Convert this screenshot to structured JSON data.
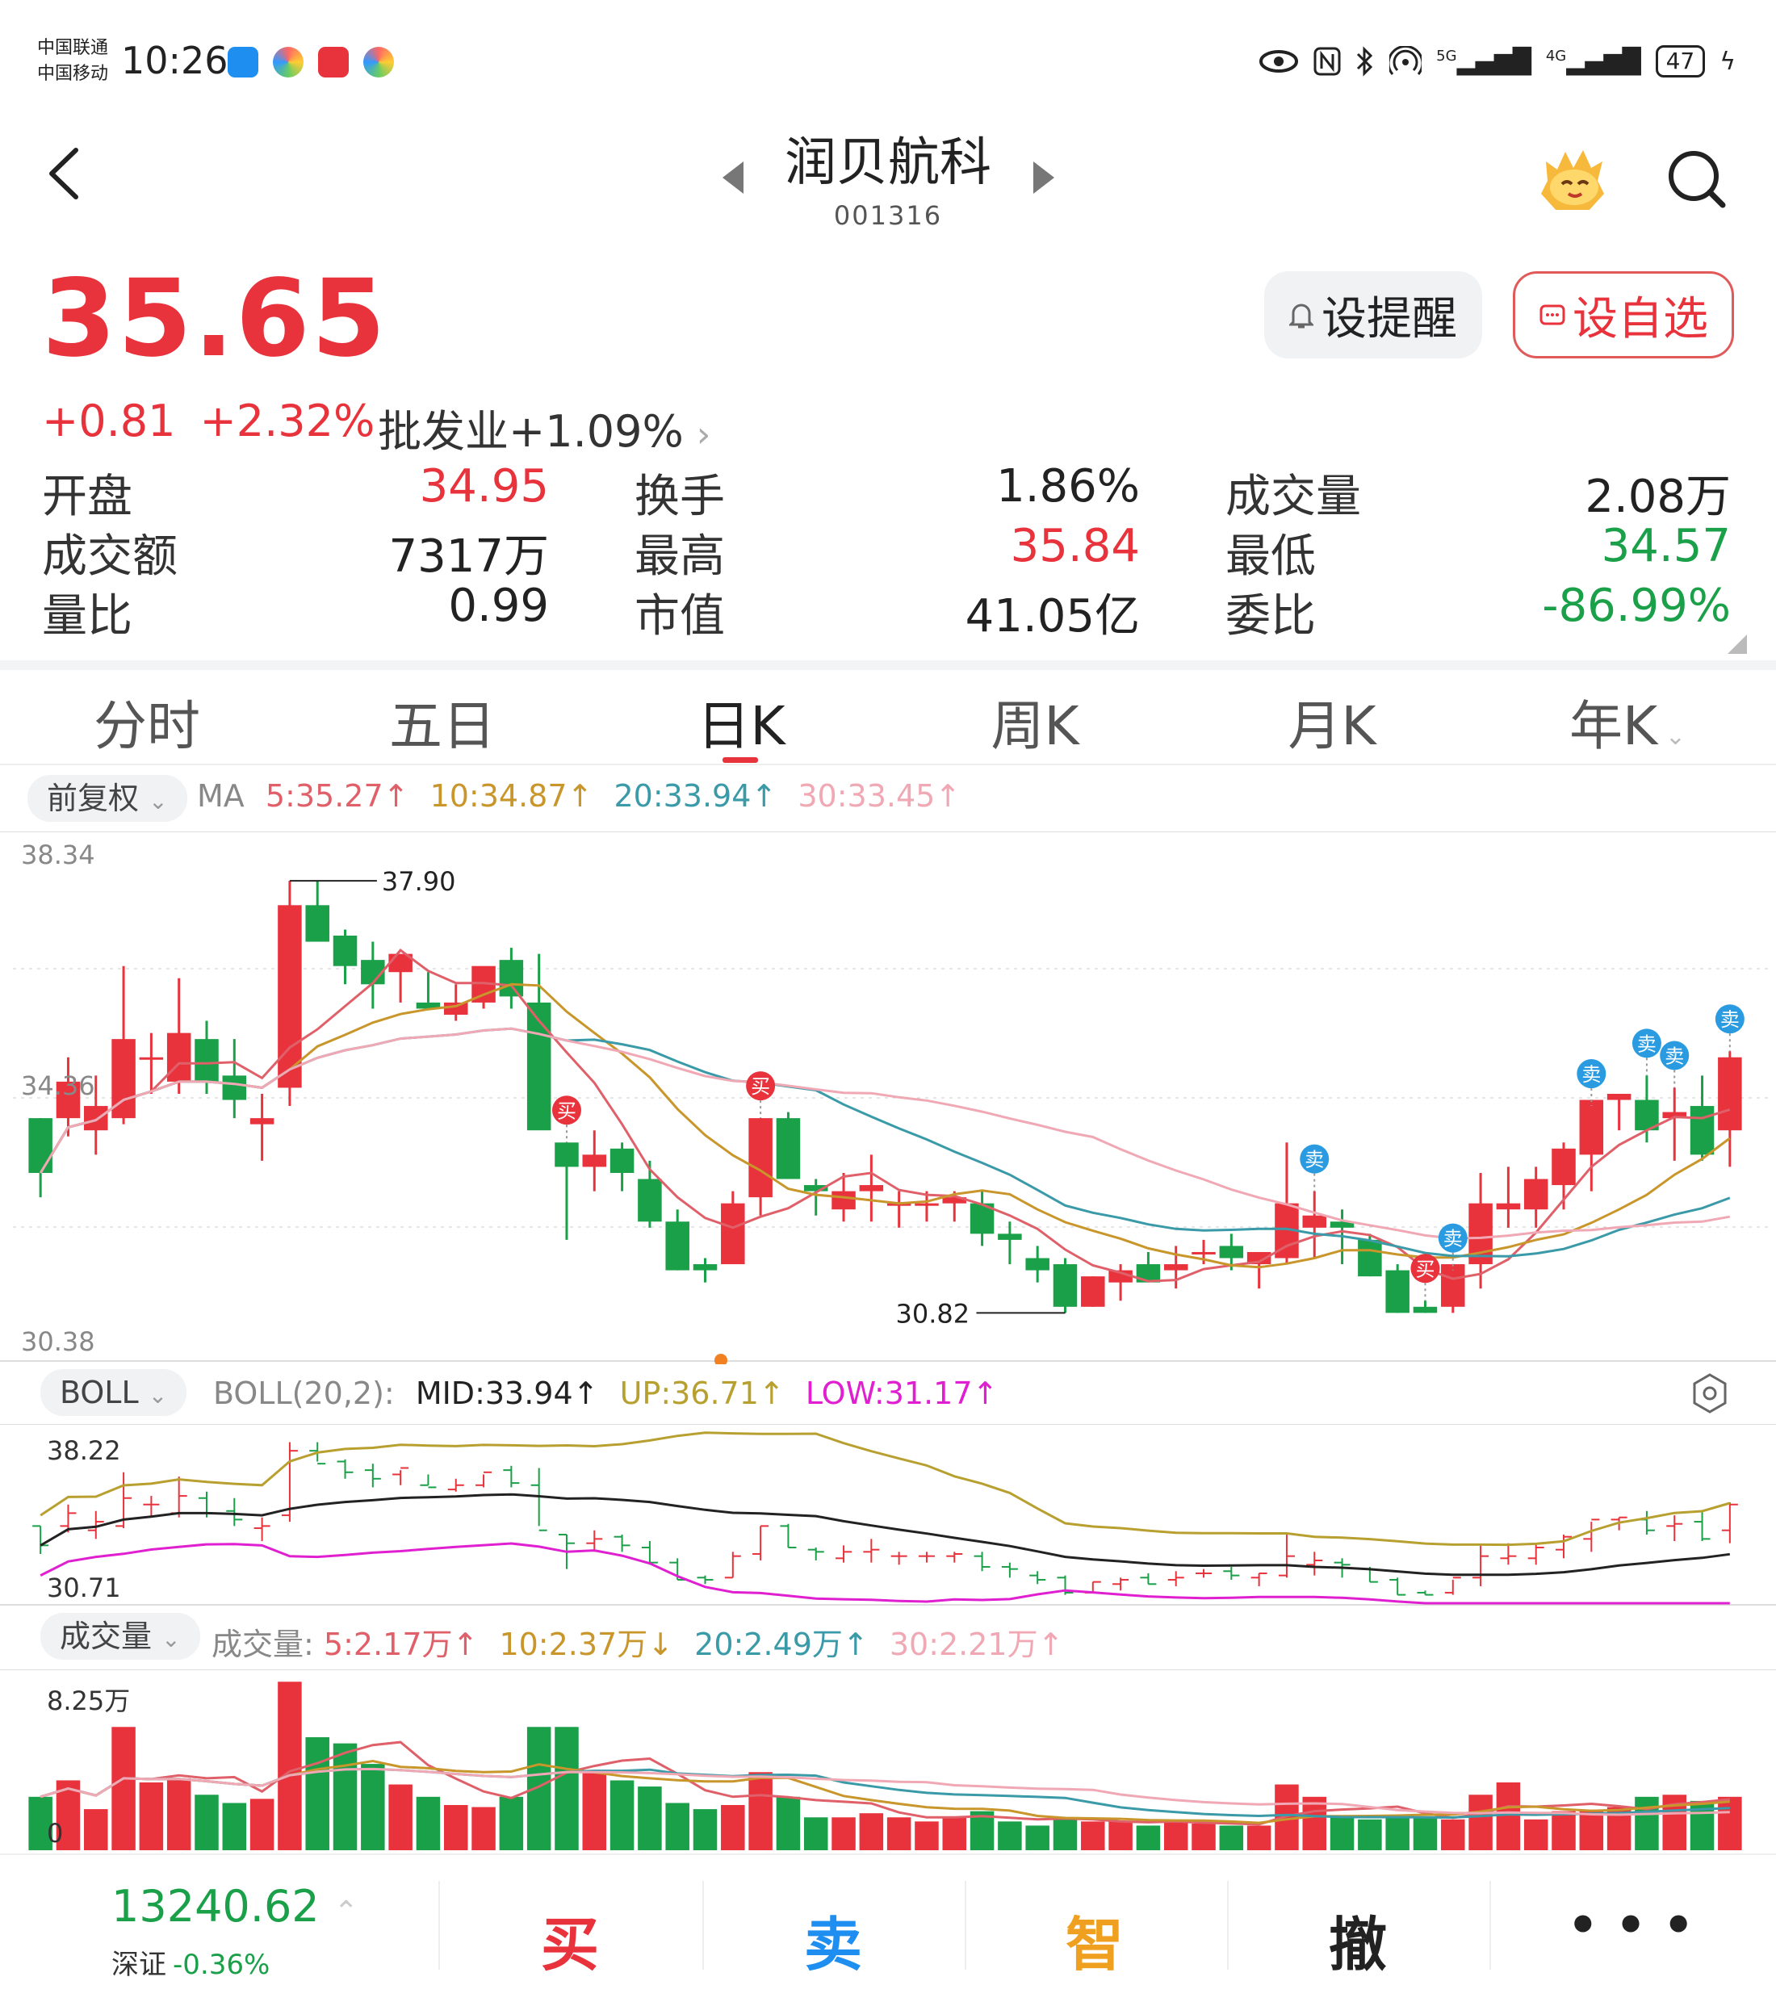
{
  "status_bar": {
    "carrier1": "中国联通",
    "carrier2": "中国移动",
    "time": "10:26",
    "signal1": "5G",
    "signal2": "4G",
    "battery": "47",
    "icons": [
      "message-icon",
      "app-icon",
      "app-icon",
      "app-icon",
      "eye-icon",
      "nfc-icon",
      "bluetooth-icon",
      "hotspot-icon"
    ]
  },
  "header": {
    "title": "润贝航科",
    "code": "001316"
  },
  "quote": {
    "price": "35.65",
    "change": "+0.81",
    "change_pct": "+2.32%",
    "sector": "批发业+1.09%",
    "alert_button": "设提醒",
    "fav_button": "设自选"
  },
  "stats": [
    {
      "label": "开盘",
      "value": "34.95",
      "color": "red"
    },
    {
      "label": "换手",
      "value": "1.86%",
      "color": "dark"
    },
    {
      "label": "成交量",
      "value": "2.08万",
      "color": "dark"
    },
    {
      "label": "成交额",
      "value": "7317万",
      "color": "dark"
    },
    {
      "label": "最高",
      "value": "35.84",
      "color": "red"
    },
    {
      "label": "最低",
      "value": "34.57",
      "color": "green"
    },
    {
      "label": "量比",
      "value": "0.99",
      "color": "dark"
    },
    {
      "label": "市值",
      "value": "41.05亿",
      "color": "dark"
    },
    {
      "label": "委比",
      "value": "-86.99%",
      "color": "green"
    }
  ],
  "tabs": [
    "分时",
    "五日",
    "日K",
    "周K",
    "月K",
    "年K"
  ],
  "active_tab": 2,
  "k_chart": {
    "adjust": "前复权",
    "ma_prefix": "MA",
    "ma": [
      {
        "text": "5:35.27↑",
        "color": "#e0606a"
      },
      {
        "text": "10:34.87↑",
        "color": "#c8962a"
      },
      {
        "text": "20:33.94↑",
        "color": "#3a9aa8"
      },
      {
        "text": "30:33.45↑",
        "color": "#f0a8b4"
      }
    ],
    "y_high": "38.34",
    "y_mid": "34.36",
    "y_low": "30.38",
    "max_label": "37.90",
    "min_label": "30.82"
  },
  "boll": {
    "name": "BOLL",
    "params": "BOLL(20,2):",
    "mid": "MID:33.94↑",
    "up": "UP:36.71↑",
    "low": "LOW:31.17↑",
    "y_high": "38.22",
    "y_low": "30.71"
  },
  "volume": {
    "name": "成交量",
    "prefix": "成交量:",
    "ma": [
      {
        "text": "5:2.17万↑",
        "color": "#e0606a"
      },
      {
        "text": "10:2.37万↓",
        "color": "#c8962a"
      },
      {
        "text": "20:2.49万↑",
        "color": "#3a9aa8"
      },
      {
        "text": "30:2.21万↑",
        "color": "#f0a8b4"
      }
    ],
    "y_high": "8.25万",
    "y_low": "0"
  },
  "signals": {
    "buy": "买",
    "sell": "卖"
  },
  "chart_data": {
    "type": "candlestick",
    "ylim": [
      30.38,
      38.34
    ],
    "ohlc": [
      [
        34.0,
        34.0,
        32.7,
        33.1
      ],
      [
        34.0,
        35.0,
        33.7,
        34.6
      ],
      [
        33.8,
        34.7,
        33.4,
        34.2
      ],
      [
        34.0,
        36.5,
        33.9,
        35.3
      ],
      [
        35.0,
        35.4,
        34.4,
        35.0
      ],
      [
        34.6,
        36.3,
        34.4,
        35.4
      ],
      [
        35.3,
        35.6,
        34.4,
        34.6
      ],
      [
        34.7,
        35.3,
        34.0,
        34.3
      ],
      [
        33.9,
        34.4,
        33.3,
        34.0
      ],
      [
        34.5,
        37.9,
        34.2,
        37.5
      ],
      [
        37.5,
        37.9,
        37.0,
        36.9
      ],
      [
        37.0,
        37.1,
        36.2,
        36.5
      ],
      [
        36.6,
        36.9,
        35.8,
        36.2
      ],
      [
        36.4,
        36.6,
        35.9,
        36.7
      ],
      [
        35.9,
        36.4,
        35.9,
        35.8
      ],
      [
        35.7,
        36.2,
        35.6,
        35.9
      ],
      [
        35.9,
        36.4,
        35.8,
        36.5
      ],
      [
        36.6,
        36.8,
        35.8,
        36.0
      ],
      [
        35.9,
        36.7,
        34.0,
        33.8
      ],
      [
        33.6,
        33.6,
        32.0,
        33.2
      ],
      [
        33.2,
        33.8,
        32.8,
        33.4
      ],
      [
        33.5,
        33.6,
        32.8,
        33.1
      ],
      [
        33.0,
        33.3,
        32.2,
        32.3
      ],
      [
        32.3,
        32.5,
        31.5,
        31.5
      ],
      [
        31.6,
        31.7,
        31.3,
        31.5
      ],
      [
        31.6,
        32.8,
        31.6,
        32.6
      ],
      [
        32.7,
        34.0,
        32.4,
        34.0
      ],
      [
        34.0,
        34.1,
        33.0,
        33.0
      ],
      [
        32.9,
        33.0,
        32.4,
        32.8
      ],
      [
        32.5,
        33.1,
        32.3,
        32.8
      ],
      [
        32.8,
        33.4,
        32.3,
        32.9
      ],
      [
        32.6,
        32.8,
        32.2,
        32.6
      ],
      [
        32.6,
        32.8,
        32.3,
        32.6
      ],
      [
        32.6,
        32.8,
        32.3,
        32.7
      ],
      [
        32.6,
        32.8,
        31.9,
        32.1
      ],
      [
        32.1,
        32.3,
        31.6,
        32.0
      ],
      [
        31.7,
        31.9,
        31.3,
        31.5
      ],
      [
        31.6,
        31.7,
        30.8,
        30.9
      ],
      [
        30.9,
        31.4,
        30.9,
        31.4
      ],
      [
        31.3,
        31.6,
        31.0,
        31.5
      ],
      [
        31.6,
        31.8,
        31.3,
        31.3
      ],
      [
        31.5,
        31.9,
        31.2,
        31.6
      ],
      [
        31.8,
        32.0,
        31.6,
        31.8
      ],
      [
        31.9,
        32.1,
        31.5,
        31.7
      ],
      [
        31.6,
        31.8,
        31.2,
        31.8
      ],
      [
        31.7,
        33.6,
        31.6,
        32.6
      ],
      [
        32.2,
        32.8,
        31.7,
        32.4
      ],
      [
        32.3,
        32.5,
        31.6,
        32.2
      ],
      [
        32.0,
        32.1,
        31.4,
        31.4
      ],
      [
        31.5,
        31.6,
        30.8,
        30.8
      ],
      [
        30.9,
        31.0,
        30.8,
        30.8
      ],
      [
        30.9,
        31.5,
        30.8,
        31.6
      ],
      [
        31.6,
        33.1,
        31.2,
        32.6
      ],
      [
        32.5,
        33.2,
        32.2,
        32.6
      ],
      [
        32.5,
        33.2,
        32.2,
        33.0
      ],
      [
        32.9,
        33.6,
        32.5,
        33.5
      ],
      [
        33.4,
        34.2,
        32.8,
        34.3
      ],
      [
        34.3,
        34.4,
        33.8,
        34.4
      ],
      [
        34.3,
        34.7,
        33.6,
        33.8
      ],
      [
        34.0,
        34.5,
        33.3,
        34.1
      ],
      [
        34.2,
        34.7,
        33.3,
        33.4
      ],
      [
        33.8,
        35.1,
        33.2,
        35.0
      ]
    ]
  }
}
